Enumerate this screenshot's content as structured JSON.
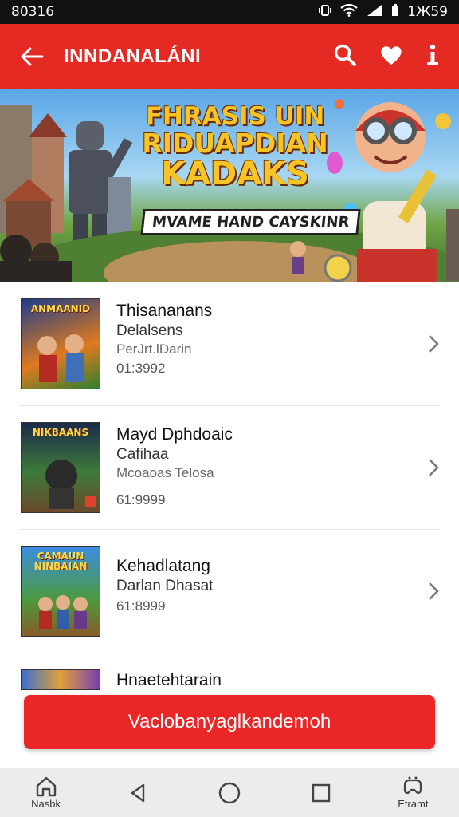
{
  "status_bar": {
    "time": "80316",
    "clock_right": "1Ж59"
  },
  "app_bar": {
    "title": "INNDANALÁNI"
  },
  "hero": {
    "title_lines": [
      "FHRASIS UIN",
      "RIDUAPDIAN",
      "KADAKS"
    ],
    "subtitle": "MVAME HAND CAYSKINR"
  },
  "list": {
    "items": [
      {
        "title": "Thisananans",
        "subtitle": "Delalsens",
        "meta": "PerJrt.lDarin",
        "price": "01:3992",
        "thumb_text": "ANMAANID"
      },
      {
        "title": "Mayd Dphdoaic",
        "subtitle": "Cafihaa",
        "meta": "Mcoaoas Telosa",
        "price": "61:9999",
        "thumb_text": "NIKBAANS"
      },
      {
        "title": "Kehadlatang",
        "subtitle": "Darlan Dhasat",
        "meta": "",
        "price": "61:8999",
        "thumb_text": "CAMAUN NINBAIAN"
      },
      {
        "title": "Hnaetehtarain",
        "subtitle": "",
        "meta": "",
        "price": "",
        "thumb_text": ""
      }
    ]
  },
  "cta": {
    "label": "Vaclobanyaglkandemoh"
  },
  "nav_bar": {
    "left_label": "Nasbk",
    "right_label": "Etramt"
  },
  "colors": {
    "accent": "#e52a24",
    "cta": "#ea2626"
  }
}
